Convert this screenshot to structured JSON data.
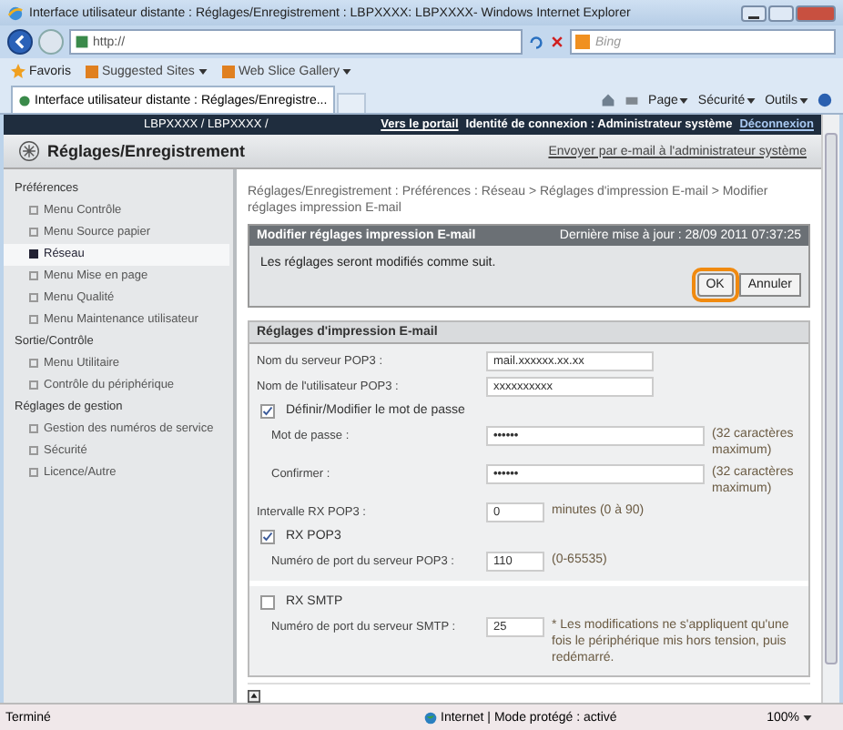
{
  "window": {
    "title": "Interface utilisateur distante : Réglages/Enregistrement : LBPXXXX: LBPXXXX- Windows Internet Explorer"
  },
  "nav": {
    "address": "http://",
    "search_placeholder": "Bing"
  },
  "favorites_bar": {
    "favorites": "Favoris",
    "links": [
      "Suggested Sites",
      "Web Slice Gallery"
    ]
  },
  "tab": {
    "title": "Interface utilisateur distante : Réglages/Enregistre..."
  },
  "command_bar": [
    "Page",
    "Sécurité",
    "Outils"
  ],
  "header": {
    "device": "LBPXXXX / LBPXXXX /",
    "portal_link": "Vers le portail",
    "login": "Identité de connexion : Administrateur système",
    "logout": "Déconnexion"
  },
  "page_title": "Réglages/Enregistrement",
  "mail_link": "Envoyer par e-mail à l'administrateur système",
  "sidebar": [
    {
      "label": "Préférences",
      "children": [
        {
          "label": "Menu Contrôle",
          "selected": false
        },
        {
          "label": "Menu Source papier",
          "selected": false
        },
        {
          "label": "Réseau",
          "selected": true
        },
        {
          "label": "Menu Mise en page",
          "selected": false
        },
        {
          "label": "Menu Qualité",
          "selected": false
        },
        {
          "label": "Menu Maintenance utilisateur",
          "selected": false
        }
      ]
    },
    {
      "label": "Sortie/Contrôle",
      "children": [
        {
          "label": "Menu Utilitaire",
          "selected": false
        },
        {
          "label": "Contrôle du périphérique",
          "selected": false
        }
      ]
    },
    {
      "label": "Réglages de gestion",
      "children": [
        {
          "label": "Gestion des numéros de service",
          "selected": false
        },
        {
          "label": "Sécurité",
          "selected": false
        },
        {
          "label": "Licence/Autre",
          "selected": false
        }
      ]
    }
  ],
  "breadcrumb": "Réglages/Enregistrement : Préférences : Réseau > Réglages d'impression E-mail > Modifier réglages impression E-mail",
  "dialog": {
    "title": "Modifier réglages impression E-mail",
    "updated": "Dernière mise à jour : 28/09 2011 07:37:25",
    "message": "Les réglages seront modifiés comme suit.",
    "buttons": [
      {
        "label": "OK",
        "focused": true
      },
      {
        "label": "Annuler",
        "focused": false
      }
    ]
  },
  "settings": {
    "title": "Réglages d'impression E-mail",
    "sections": [
      {
        "rows": [
          {
            "kind": "text",
            "label": "Nom du serveur POP3 :",
            "value": "mail.xxxxxx.xx.xx"
          },
          {
            "kind": "text",
            "label": "Nom de l'utilisateur POP3 :",
            "value": "xxxxxxxxxx"
          },
          {
            "kind": "checkbox",
            "label": "Définir/Modifier le mot de passe",
            "checked": true,
            "children": [
              {
                "kind": "password",
                "label": "Mot de passe :",
                "value": "••••••",
                "hint": "(32 caractères maximum)"
              },
              {
                "kind": "password",
                "label": "Confirmer :",
                "value": "••••••",
                "hint": "(32 caractères maximum)"
              }
            ]
          },
          {
            "kind": "number",
            "label": "Intervalle RX POP3 :",
            "value": "0",
            "hint": "minutes (0 à 90)"
          },
          {
            "kind": "checkbox",
            "label": "RX POP3",
            "checked": true,
            "children": [
              {
                "kind": "number",
                "label": "Numéro de port du serveur POP3 :",
                "value": "110",
                "hint": "(0-65535)"
              }
            ]
          }
        ]
      },
      {
        "rows": [
          {
            "kind": "checkbox",
            "label": "RX SMTP",
            "checked": false,
            "children": [
              {
                "kind": "number",
                "label": "Numéro de port du serveur SMTP :",
                "value": "25",
                "hint": "* Les modifications ne s'appliquent qu'une fois le périphérique mis hors tension, puis redémarré."
              }
            ]
          }
        ]
      }
    ]
  },
  "status_bar": {
    "status": "Terminé",
    "zone": "Internet | Mode protégé : activé",
    "zoom": "100%"
  }
}
